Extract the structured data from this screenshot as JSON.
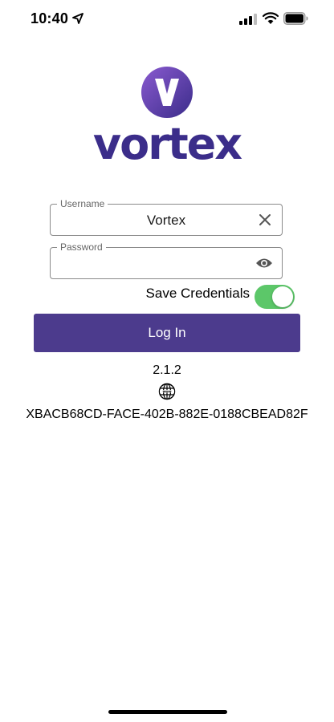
{
  "status_bar": {
    "time": "10:40",
    "icons": [
      "location-arrow-icon",
      "cellular-signal-icon",
      "wifi-icon",
      "battery-icon"
    ]
  },
  "logo": {
    "mark_letter": "V",
    "wordmark": "vortex",
    "brand_color": "#3b2d8a",
    "mark_gradient": [
      "#7a4fc2",
      "#3b2d8a"
    ]
  },
  "login_form": {
    "username": {
      "label": "Username",
      "value": "Vortex",
      "clear_icon": "close-icon"
    },
    "password": {
      "label": "Password",
      "value": "",
      "toggle_icon": "eye-icon"
    },
    "save_credentials": {
      "label": "Save Credentials",
      "enabled": true,
      "on_color": "#5cc769"
    },
    "login_button": {
      "label": "Log In",
      "color": "#4c3b8d"
    }
  },
  "footer": {
    "version": "2.1.2",
    "globe_icon": "globe-icon",
    "device_id": "XBACB68CD-FACE-402B-882E-0188CBEAD82F"
  }
}
